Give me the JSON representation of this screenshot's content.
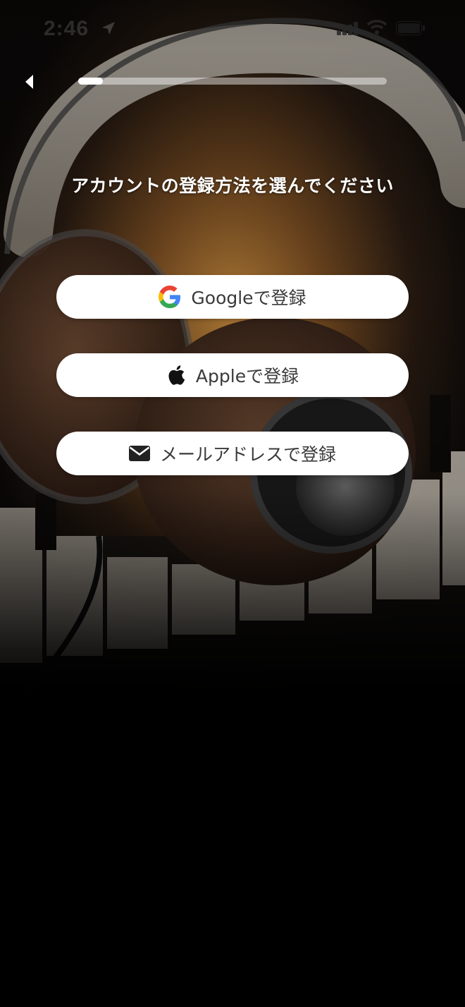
{
  "status_bar": {
    "time": "2:46"
  },
  "navigation": {
    "back_icon": "back-chevron-icon",
    "progress_fraction": 0.08
  },
  "heading": "アカウントの登録方法を選んでください",
  "signup_options": [
    {
      "id": "google",
      "icon": "google-icon",
      "label": "Googleで登録"
    },
    {
      "id": "apple",
      "icon": "apple-icon",
      "label": "Appleで登録"
    },
    {
      "id": "email",
      "icon": "envelope-icon",
      "label": "メールアドレスで登録"
    }
  ],
  "colors": {
    "background": "#000000",
    "button_background": "#ffffff",
    "button_text": "#3a3a3a",
    "heading_text": "#ffffff",
    "google_blue": "#4285F4",
    "google_red": "#EA4335",
    "google_yellow": "#FBBC05",
    "google_green": "#34A853"
  }
}
